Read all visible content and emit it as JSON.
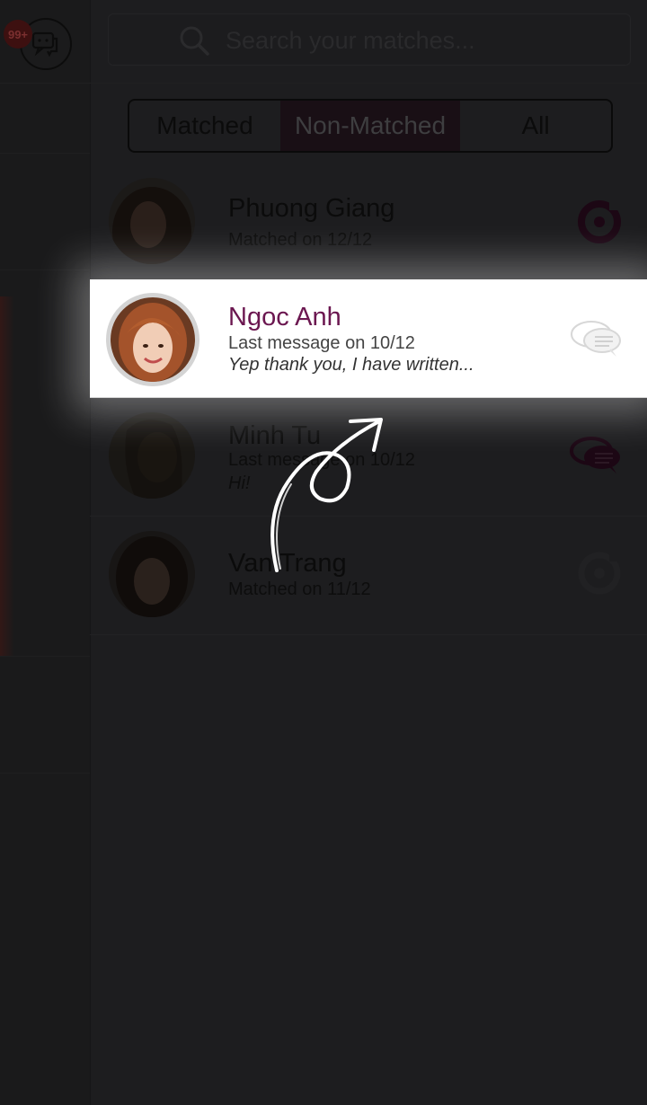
{
  "header": {
    "badge_count": "99+",
    "search_placeholder": "Search your matches..."
  },
  "tabs": [
    "Matched",
    "Non-Matched",
    "All"
  ],
  "selected_tab": "Non-Matched",
  "matches": [
    {
      "name": "Phuong Giang",
      "status": "Matched on 12/12",
      "message": "",
      "icon": "target-icon"
    },
    {
      "name": "Ngoc Anh",
      "status": "Last message on 10/12",
      "message": "Yep thank you, I have written...",
      "icon": "chat-bubbles-icon",
      "highlighted": true
    },
    {
      "name": "Minh Tu",
      "status": "Last message on 10/12",
      "message": "Hi!",
      "icon": "chat-bubbles-icon"
    },
    {
      "name": "Van Trang",
      "status": "Matched on 11/12",
      "message": "",
      "icon": "target-icon"
    }
  ],
  "colors": {
    "accent": "#6b1750",
    "overlay": "#1d1d1f",
    "highlight": "#ffffff"
  }
}
